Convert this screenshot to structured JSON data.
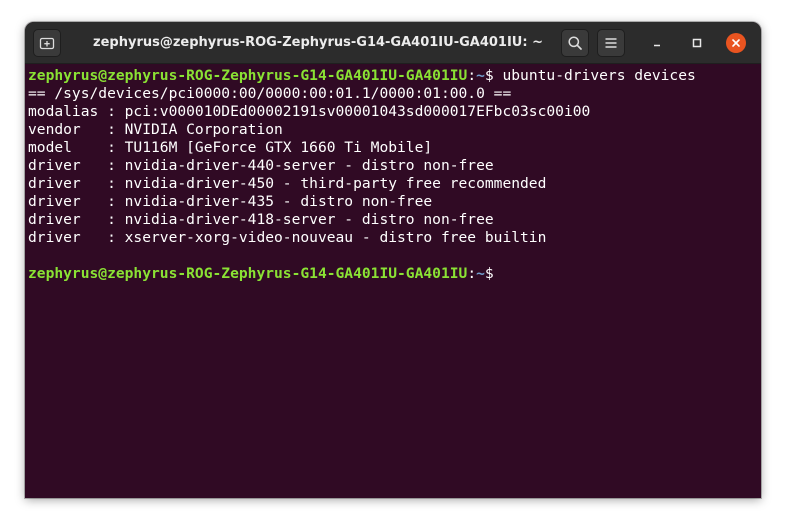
{
  "window": {
    "title": "zephyrus@zephyrus-ROG-Zephyrus-G14-GA401IU-GA401IU: ~"
  },
  "prompt": {
    "user_host": "zephyrus@zephyrus-ROG-Zephyrus-G14-GA401IU-GA401IU",
    "sep": ":",
    "path": "~",
    "symbol": "$ "
  },
  "command": "ubuntu-drivers devices",
  "output": [
    "== /sys/devices/pci0000:00/0000:00:01.1/0000:01:00.0 ==",
    "modalias : pci:v000010DEd00002191sv00001043sd000017EFbc03sc00i00",
    "vendor   : NVIDIA Corporation",
    "model    : TU116M [GeForce GTX 1660 Ti Mobile]",
    "driver   : nvidia-driver-440-server - distro non-free",
    "driver   : nvidia-driver-450 - third-party free recommended",
    "driver   : nvidia-driver-435 - distro non-free",
    "driver   : nvidia-driver-418-server - distro non-free",
    "driver   : xserver-xorg-video-nouveau - distro free builtin"
  ],
  "colors": {
    "terminal_bg": "#300a24",
    "prompt_user": "#8ae234",
    "prompt_path": "#729fcf",
    "close_button": "#e95420"
  },
  "icons": {
    "new_tab": "new-tab-icon",
    "search": "search-icon",
    "menu": "hamburger-menu-icon",
    "minimize": "minimize-icon",
    "maximize": "maximize-icon",
    "close": "close-icon"
  }
}
